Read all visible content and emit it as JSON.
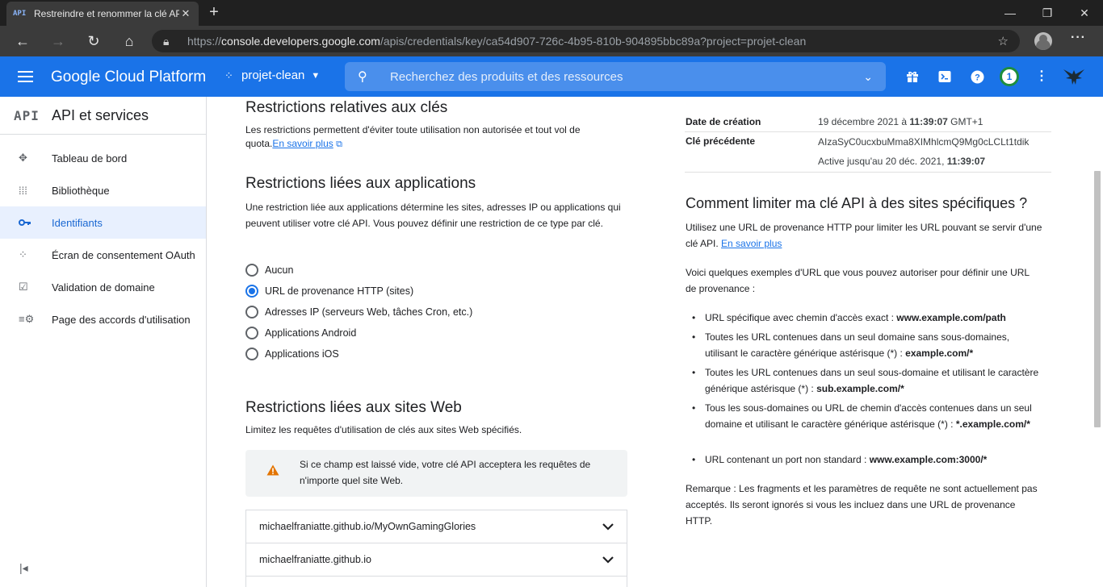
{
  "browser": {
    "tab_title": "Restreindre et renommer la clé API",
    "tab_favicon": "API",
    "url_prefix": "https://",
    "url_host": "console.developers.google.com",
    "url_path": "/apis/credentials/key/ca54d907-726c-4b95-810b-904895bbc89a?project=projet-clean"
  },
  "header": {
    "brand": "Google Cloud Platform",
    "project": "projet-clean",
    "search_placeholder": "Recherchez des produits et des ressources",
    "notification_count": "1"
  },
  "sidebar": {
    "logo": "API",
    "title": "API et services",
    "items": [
      {
        "label": "Tableau de bord",
        "icon": "dashboard-icon"
      },
      {
        "label": "Bibliothèque",
        "icon": "library-icon"
      },
      {
        "label": "Identifiants",
        "icon": "key-icon",
        "active": true
      },
      {
        "label": "Écran de consentement OAuth",
        "icon": "consent-icon"
      },
      {
        "label": "Validation de domaine",
        "icon": "checkbox-icon"
      },
      {
        "label": "Page des accords d'utilisation",
        "icon": "settings-list-icon"
      }
    ]
  },
  "main": {
    "key_restrictions_title": "Restrictions relatives aux clés",
    "key_restrictions_text": "Les restrictions permettent d'éviter toute utilisation non autorisée et tout vol de quota.",
    "learn_more": "En savoir plus",
    "app_restrictions_title": "Restrictions liées aux applications",
    "app_restrictions_text": "Une restriction liée aux applications détermine les sites, adresses IP ou applications qui peuvent utiliser votre clé API. Vous pouvez définir une restriction de ce type par clé.",
    "radio_options": [
      {
        "label": "Aucun",
        "selected": false
      },
      {
        "label": "URL de provenance HTTP (sites)",
        "selected": true
      },
      {
        "label": "Adresses IP (serveurs Web, tâches Cron, etc.)",
        "selected": false
      },
      {
        "label": "Applications Android",
        "selected": false
      },
      {
        "label": "Applications iOS",
        "selected": false
      }
    ],
    "web_restrictions_title": "Restrictions liées aux sites Web",
    "web_restrictions_text": "Limitez les requêtes d'utilisation de clés aux sites Web spécifiés.",
    "warning_text": "Si ce champ est laissé vide, votre clé API acceptera les requêtes de n'importe quel site Web.",
    "referrers": [
      "michaelfraniatte.github.io/MyOwnGamingGlories",
      "michaelfraniatte.github.io"
    ]
  },
  "right": {
    "created_label": "Date de création",
    "created_value_pre": "19 décembre 2021 à ",
    "created_value_bold": "11:39:07",
    "created_value_post": " GMT+1",
    "prev_key_label": "Clé précédente",
    "prev_key_value": "AIzaSyC0ucxbuMma8XIMhlcmQ9Mg0cLCLt1tdik",
    "prev_key_active_pre": "Active jusqu'au 20 déc. 2021, ",
    "prev_key_active_bold": "11:39:07",
    "howto_title": "Comment limiter ma clé API à des sites spécifiques ?",
    "howto_text": "Utilisez une URL de provenance HTTP pour limiter les URL pouvant se servir d'une clé API.",
    "learn_more": "En savoir plus",
    "examples_intro": "Voici quelques exemples d'URL que vous pouvez autoriser pour définir une URL de provenance :",
    "examples": [
      {
        "text": "URL spécifique avec chemin d'accès exact : ",
        "bold": "www.example.com/path"
      },
      {
        "text": "Toutes les URL contenues dans un seul domaine sans sous-domaines, utilisant le caractère générique astérisque (*) : ",
        "bold": "example.com/*"
      },
      {
        "text": "Toutes les URL contenues dans un seul sous-domaine et utilisant le caractère générique astérisque (*) : ",
        "bold": "sub.example.com/*"
      },
      {
        "text": "Tous les sous-domaines ou URL de chemin d'accès contenues dans un seul domaine et utilisant le caractère générique astérisque (*) : ",
        "bold": "*.example.com/*"
      },
      {
        "text": "URL contenant un port non standard : ",
        "bold": "www.example.com:3000/*"
      }
    ],
    "remark": "Remarque : Les fragments et les paramètres de requête ne sont actuellement pas acceptés. Ils seront ignorés si vous les incluez dans une URL de provenance HTTP."
  },
  "colors": {
    "gcp_blue": "#1a73e8",
    "active_bg": "#e8f0fe",
    "warning": "#e37400"
  }
}
